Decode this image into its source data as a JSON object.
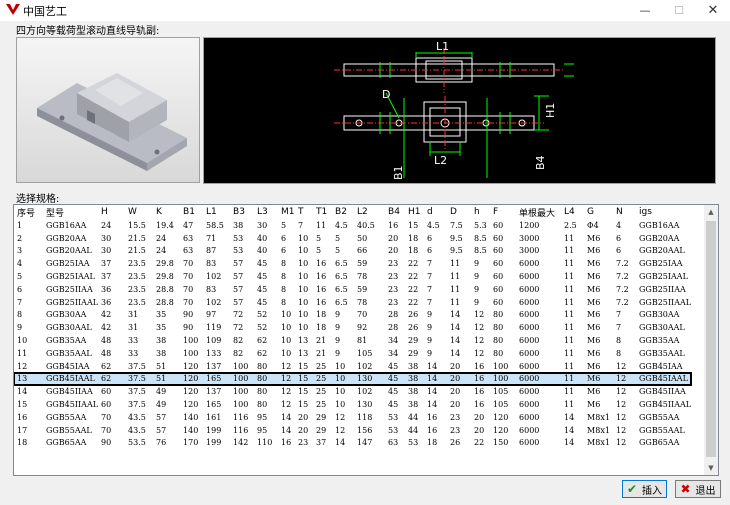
{
  "window": {
    "title": "中国艺工",
    "min": "—",
    "max": "☐",
    "close": "✕"
  },
  "preview_label": "四方向等载荷型滚动直线导轨副:",
  "cad_labels": {
    "l1": "L1",
    "l2": "L2",
    "d": "D",
    "h1": "H1",
    "b1": "B1",
    "b4": "B4"
  },
  "spec_label": "选择规格:",
  "table": {
    "columns": [
      "序号",
      "型号",
      "H",
      "W",
      "K",
      "B1",
      "L1",
      "B3",
      "L3",
      "M1",
      "T",
      "T1",
      "B2",
      "L2",
      "B4",
      "H1",
      "d",
      "D",
      "h",
      "F",
      "单根最大",
      "L4",
      "G",
      "N",
      "igs"
    ],
    "rows": [
      [
        "1",
        "GGB16AA",
        "24",
        "15.5",
        "19.4",
        "47",
        "58.5",
        "38",
        "30",
        "5",
        "7",
        "11",
        "4.5",
        "40.5",
        "16",
        "15",
        "4.5",
        "7.5",
        "5.3",
        "60",
        "1200",
        "2.5",
        "Φ4",
        "4",
        "GGB16AA"
      ],
      [
        "2",
        "GGB20AA",
        "30",
        "21.5",
        "24",
        "63",
        "71",
        "53",
        "40",
        "6",
        "10",
        "5",
        "5",
        "50",
        "20",
        "18",
        "6",
        "9.5",
        "8.5",
        "60",
        "3000",
        "11",
        "M6",
        "6",
        "GGB20AA"
      ],
      [
        "3",
        "GGB20AAL",
        "30",
        "21.5",
        "24",
        "63",
        "87",
        "53",
        "40",
        "6",
        "10",
        "5",
        "5",
        "66",
        "20",
        "18",
        "6",
        "9.5",
        "8.5",
        "60",
        "3000",
        "11",
        "M6",
        "6",
        "GGB20AAL"
      ],
      [
        "4",
        "GGB25IAA",
        "37",
        "23.5",
        "29.8",
        "70",
        "83",
        "57",
        "45",
        "8",
        "10",
        "16",
        "6.5",
        "59",
        "23",
        "22",
        "7",
        "11",
        "9",
        "60",
        "6000",
        "11",
        "M6",
        "7.2",
        "GGB25IAA"
      ],
      [
        "5",
        "GGB25IAAL",
        "37",
        "23.5",
        "29.8",
        "70",
        "102",
        "57",
        "45",
        "8",
        "10",
        "16",
        "6.5",
        "78",
        "23",
        "22",
        "7",
        "11",
        "9",
        "60",
        "6000",
        "11",
        "M6",
        "7.2",
        "GGB25IAAL"
      ],
      [
        "6",
        "GGB25IIAA",
        "36",
        "23.5",
        "28.8",
        "70",
        "83",
        "57",
        "45",
        "8",
        "10",
        "16",
        "6.5",
        "59",
        "23",
        "22",
        "7",
        "11",
        "9",
        "60",
        "6000",
        "11",
        "M6",
        "7.2",
        "GGB25IIAA"
      ],
      [
        "7",
        "GGB25IIAAL",
        "36",
        "23.5",
        "28.8",
        "70",
        "102",
        "57",
        "45",
        "8",
        "10",
        "16",
        "6.5",
        "78",
        "23",
        "22",
        "7",
        "11",
        "9",
        "60",
        "6000",
        "11",
        "M6",
        "7.2",
        "GGB25IIAAL"
      ],
      [
        "8",
        "GGB30AA",
        "42",
        "31",
        "35",
        "90",
        "97",
        "72",
        "52",
        "10",
        "10",
        "18",
        "9",
        "70",
        "28",
        "26",
        "9",
        "14",
        "12",
        "80",
        "6000",
        "11",
        "M6",
        "7",
        "GGB30AA"
      ],
      [
        "9",
        "GGB30AAL",
        "42",
        "31",
        "35",
        "90",
        "119",
        "72",
        "52",
        "10",
        "10",
        "18",
        "9",
        "92",
        "28",
        "26",
        "9",
        "14",
        "12",
        "80",
        "6000",
        "11",
        "M6",
        "7",
        "GGB30AAL"
      ],
      [
        "10",
        "GGB35AA",
        "48",
        "33",
        "38",
        "100",
        "109",
        "82",
        "62",
        "10",
        "13",
        "21",
        "9",
        "81",
        "34",
        "29",
        "9",
        "14",
        "12",
        "80",
        "6000",
        "11",
        "M6",
        "8",
        "GGB35AA"
      ],
      [
        "11",
        "GGB35AAL",
        "48",
        "33",
        "38",
        "100",
        "133",
        "82",
        "62",
        "10",
        "13",
        "21",
        "9",
        "105",
        "34",
        "29",
        "9",
        "14",
        "12",
        "80",
        "6000",
        "11",
        "M6",
        "8",
        "GGB35AAL"
      ],
      [
        "12",
        "GGB45IAA",
        "62",
        "37.5",
        "51",
        "120",
        "137",
        "100",
        "80",
        "12",
        "15",
        "25",
        "10",
        "102",
        "45",
        "38",
        "14",
        "20",
        "16",
        "100",
        "6000",
        "11",
        "M6",
        "12",
        "GGB45IAA"
      ],
      [
        "13",
        "GGB45IAAL",
        "62",
        "37.5",
        "51",
        "120",
        "165",
        "100",
        "80",
        "12",
        "15",
        "25",
        "10",
        "130",
        "45",
        "38",
        "14",
        "20",
        "16",
        "100",
        "6000",
        "11",
        "M6",
        "12",
        "GGB45IAAL"
      ],
      [
        "14",
        "GGB45IIAA",
        "60",
        "37.5",
        "49",
        "120",
        "137",
        "100",
        "80",
        "12",
        "15",
        "25",
        "10",
        "102",
        "45",
        "38",
        "14",
        "20",
        "16",
        "105",
        "6000",
        "11",
        "M6",
        "12",
        "GGB45IIAA"
      ],
      [
        "15",
        "GGB45IIAAL",
        "60",
        "37.5",
        "49",
        "120",
        "165",
        "100",
        "80",
        "12",
        "15",
        "25",
        "10",
        "130",
        "45",
        "38",
        "14",
        "20",
        "16",
        "105",
        "6000",
        "11",
        "M6",
        "12",
        "GGB45IIAAL"
      ],
      [
        "16",
        "GGB55AA",
        "70",
        "43.5",
        "57",
        "140",
        "161",
        "116",
        "95",
        "14",
        "20",
        "29",
        "12",
        "118",
        "53",
        "44",
        "16",
        "23",
        "20",
        "120",
        "6000",
        "14",
        "M8x1",
        "12",
        "GGB55AA"
      ],
      [
        "17",
        "GGB55AAL",
        "70",
        "43.5",
        "57",
        "140",
        "199",
        "116",
        "95",
        "14",
        "20",
        "29",
        "12",
        "156",
        "53",
        "44",
        "16",
        "23",
        "20",
        "120",
        "6000",
        "14",
        "M8x1",
        "12",
        "GGB55AAL"
      ],
      [
        "18",
        "GGB65AA",
        "90",
        "53.5",
        "76",
        "170",
        "199",
        "142",
        "110",
        "16",
        "23",
        "37",
        "14",
        "147",
        "63",
        "53",
        "18",
        "26",
        "22",
        "150",
        "6000",
        "14",
        "M8x1",
        "12",
        "GGB65AA"
      ]
    ],
    "selected_index": 12
  },
  "buttons": {
    "insert": "插入",
    "exit": "退出"
  },
  "colors": {
    "selection": "#cce4f7",
    "cad_bg": "#000000",
    "cad_line": "#ffffff",
    "cad_center": "#ff3030",
    "cad_dim": "#00ff00"
  }
}
